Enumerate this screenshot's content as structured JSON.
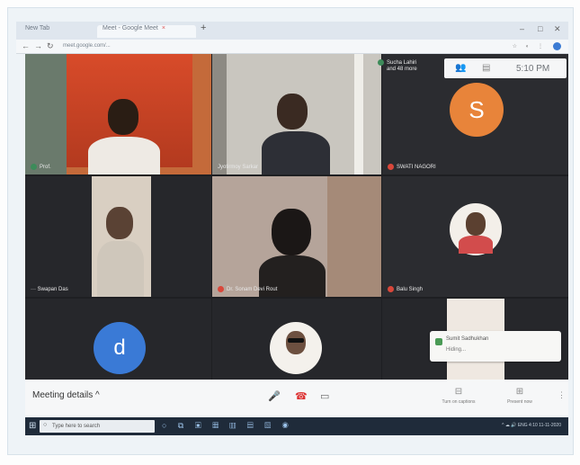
{
  "browser": {
    "tabs": [
      {
        "label": "New Tab"
      },
      {
        "label": "Meet - Google Meet"
      }
    ],
    "new_tab_symbol": "+",
    "address": "meet.google.com/...",
    "window_controls": [
      "–",
      "□",
      "✕"
    ]
  },
  "meet": {
    "top_overlay": {
      "participants_label": "Sucha Lahiri",
      "participants_sub": "and 48 more",
      "time": "5:10 PM"
    },
    "tiles": [
      {
        "name": "Prof.",
        "avatar_letter": ""
      },
      {
        "name": "Jyotirmoy Sarkar",
        "avatar_letter": ""
      },
      {
        "name": "SWATI NAGORI",
        "avatar_letter": "S",
        "avatar_color": "#e8843a"
      },
      {
        "name": "Swapan Das",
        "avatar_letter": ""
      },
      {
        "name": "Dr. Sonam Devi Rout",
        "avatar_letter": ""
      },
      {
        "name": "Balu Singh",
        "avatar_letter": ""
      },
      {
        "name": "",
        "avatar_letter": "d",
        "avatar_color": "#3a7ad6"
      },
      {
        "name": "",
        "avatar_letter": ""
      },
      {
        "name": "",
        "avatar_letter": ""
      }
    ],
    "notification": {
      "title": "Sumit Sadhukhan",
      "subtitle": "Hiding..."
    },
    "bottom_bar": {
      "meeting_code": "Meeting details ^",
      "captions_label": "Turn on captions",
      "present_label": "Present now"
    }
  },
  "taskbar": {
    "search_placeholder": "Type here to search",
    "tray_text": "^ ☁ 🔊 ENG  4:10  11-11-2020"
  }
}
